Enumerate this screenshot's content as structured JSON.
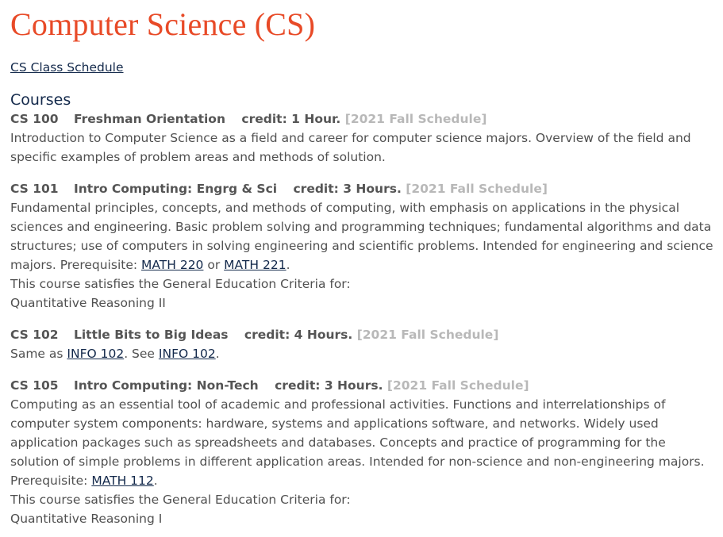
{
  "title": "Computer Science (CS)",
  "schedule_link": "CS Class Schedule",
  "section_heading": "Courses",
  "courses": [
    {
      "number": "CS 100",
      "name": "Freshman Orientation",
      "credit": "credit: 1 Hour.",
      "schedule": "[2021 Fall Schedule]",
      "desc_before": "Introduction to Computer Science as a field and career for computer science majors. Overview of the field and specific examples of problem areas and methods of solution."
    },
    {
      "number": "CS 101",
      "name": "Intro Computing: Engrg & Sci",
      "credit": "credit: 3 Hours.",
      "schedule": "[2021 Fall Schedule]",
      "desc_before": "Fundamental principles, concepts, and methods of computing, with emphasis on applications in the physical sciences and engineering. Basic problem solving and programming techniques; fundamental algorithms and data structures; use of computers in solving engineering and scientific problems. Intended for engineering and science majors. Prerequisite: ",
      "link1": "MATH 220",
      "between": " or ",
      "link2": "MATH 221",
      "after": ".",
      "gened_intro": "This course satisfies the General Education Criteria for:",
      "gened_value": "Quantitative Reasoning II"
    },
    {
      "number": "CS 102",
      "name": "Little Bits to Big Ideas",
      "credit": "credit: 4 Hours.",
      "schedule": "[2021 Fall Schedule]",
      "desc_before": "Same as ",
      "link1": "INFO 102",
      "between": ". See ",
      "link2": "INFO 102",
      "after": "."
    },
    {
      "number": "CS 105",
      "name": "Intro Computing: Non-Tech",
      "credit": "credit: 3 Hours.",
      "schedule": "[2021 Fall Schedule]",
      "desc_before": "Computing as an essential tool of academic and professional activities. Functions and interrelationships of computer system components: hardware, systems and applications software, and networks. Widely used application packages such as spreadsheets and databases. Concepts and practice of programming for the solution of simple problems in different application areas. Intended for non-science and non-engineering majors. Prerequisite: ",
      "link1": "MATH 112",
      "after": ".",
      "gened_intro": "This course satisfies the General Education Criteria for:",
      "gened_value": "Quantitative Reasoning I"
    }
  ]
}
